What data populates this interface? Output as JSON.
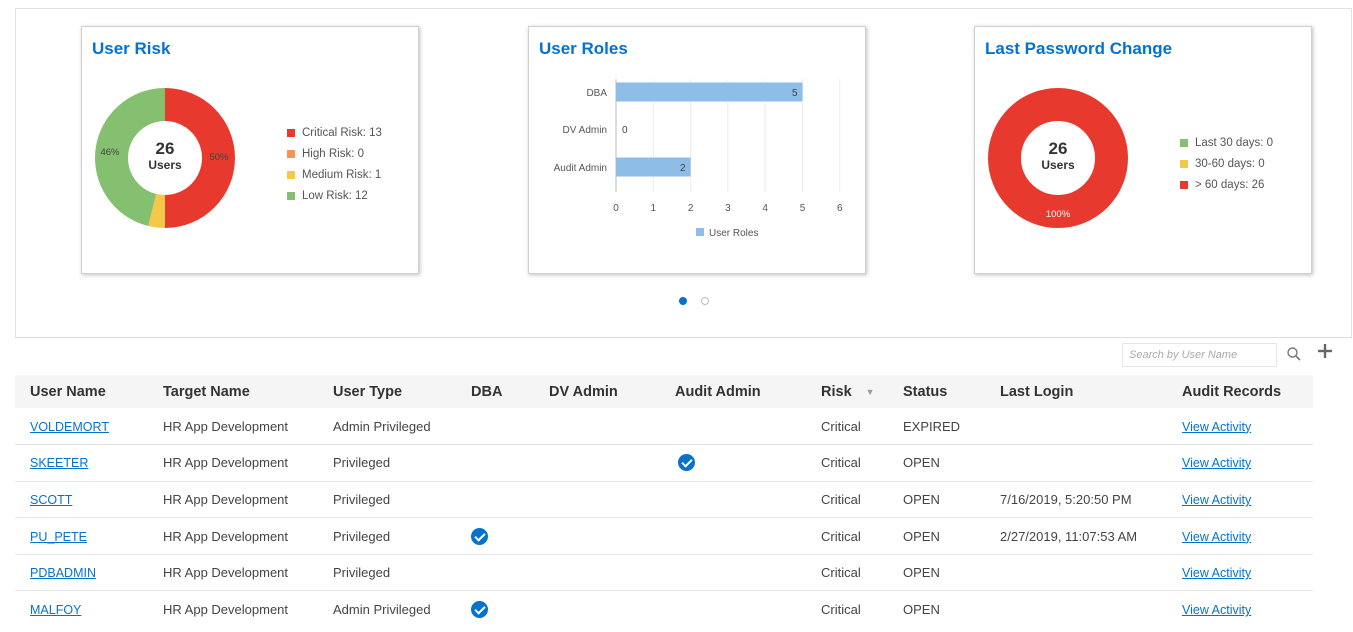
{
  "colors": {
    "critical": "#e8392f",
    "high": "#f0945a",
    "medium": "#f5c84a",
    "low": "#84c06f",
    "bar": "#8ebde8",
    "accent": "#0572ce"
  },
  "cards": {
    "user_risk": {
      "title": "User Risk",
      "center_count": "26",
      "center_label": "Users",
      "label_left": "46%",
      "label_right": "50%",
      "legend": [
        {
          "label": "Critical Risk: 13",
          "color": "#e8392f"
        },
        {
          "label": "High Risk: 0",
          "color": "#f0945a"
        },
        {
          "label": "Medium Risk: 1",
          "color": "#f5c84a"
        },
        {
          "label": "Low Risk: 12",
          "color": "#84c06f"
        }
      ]
    },
    "user_roles": {
      "title": "User Roles",
      "legend_label": "User Roles"
    },
    "password": {
      "title": "Last Password Change",
      "center_count": "26",
      "center_label": "Users",
      "label_bottom": "100%",
      "legend": [
        {
          "label": "Last 30 days: 0",
          "color": "#84c06f"
        },
        {
          "label": "30-60 days: 0",
          "color": "#f5c84a"
        },
        {
          "label": "> 60 days: 26",
          "color": "#e8392f"
        }
      ]
    }
  },
  "chart_data": [
    {
      "type": "pie",
      "title": "User Risk",
      "categories": [
        "Critical Risk",
        "High Risk",
        "Medium Risk",
        "Low Risk"
      ],
      "values": [
        13,
        0,
        1,
        12
      ]
    },
    {
      "type": "bar",
      "title": "User Roles",
      "categories": [
        "DBA",
        "DV Admin",
        "Audit Admin"
      ],
      "series": [
        {
          "name": "User Roles",
          "values": [
            5,
            0,
            2
          ]
        }
      ],
      "xlim": [
        0,
        6
      ],
      "ticks": [
        "0",
        "1",
        "2",
        "3",
        "4",
        "5",
        "6"
      ]
    },
    {
      "type": "pie",
      "title": "Last Password Change",
      "categories": [
        "Last 30 days",
        "30-60 days",
        "> 60 days"
      ],
      "values": [
        0,
        0,
        26
      ]
    }
  ],
  "search": {
    "placeholder": "Search by User Name"
  },
  "table": {
    "columns": [
      "User Name",
      "Target Name",
      "User Type",
      "DBA",
      "DV Admin",
      "Audit Admin",
      "Risk",
      "Status",
      "Last Login",
      "Audit Records"
    ],
    "rows": [
      {
        "user": "VOLDEMORT",
        "target": "HR App Development",
        "type": "Admin Privileged",
        "dba": false,
        "dv": false,
        "audit": false,
        "risk": "Critical",
        "status": "EXPIRED",
        "login": "",
        "records": "View Activity"
      },
      {
        "user": "SKEETER",
        "target": "HR App Development",
        "type": "Privileged",
        "dba": false,
        "dv": false,
        "audit": true,
        "risk": "Critical",
        "status": "OPEN",
        "login": "",
        "records": "View Activity"
      },
      {
        "user": "SCOTT",
        "target": "HR App Development",
        "type": "Privileged",
        "dba": false,
        "dv": false,
        "audit": false,
        "risk": "Critical",
        "status": "OPEN",
        "login": "7/16/2019, 5:20:50 PM",
        "records": "View Activity"
      },
      {
        "user": "PU_PETE",
        "target": "HR App Development",
        "type": "Privileged",
        "dba": true,
        "dv": false,
        "audit": false,
        "risk": "Critical",
        "status": "OPEN",
        "login": "2/27/2019, 11:07:53 AM",
        "records": "View Activity"
      },
      {
        "user": "PDBADMIN",
        "target": "HR App Development",
        "type": "Privileged",
        "dba": false,
        "dv": false,
        "audit": false,
        "risk": "Critical",
        "status": "OPEN",
        "login": "",
        "records": "View Activity"
      },
      {
        "user": "MALFOY",
        "target": "HR App Development",
        "type": "Admin Privileged",
        "dba": true,
        "dv": false,
        "audit": false,
        "risk": "Critical",
        "status": "OPEN",
        "login": "",
        "records": "View Activity"
      }
    ]
  }
}
